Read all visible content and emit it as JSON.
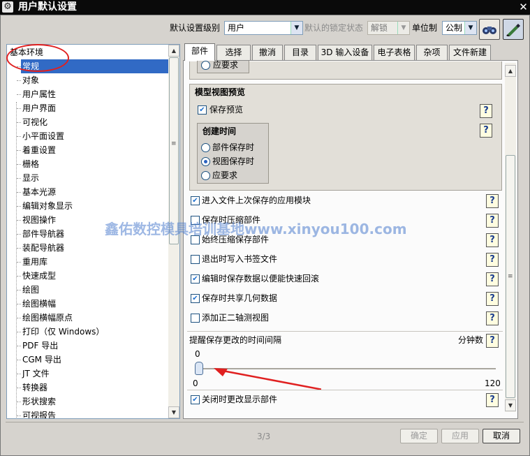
{
  "window": {
    "title": "用户默认设置",
    "close_icon": "✕"
  },
  "toolbar": {
    "level_label": "默认设置级别",
    "level_value": "用户",
    "lock_label": "默认的锁定状态",
    "lock_value": "解锁",
    "unit_label": "单位制",
    "unit_value": "公制"
  },
  "tree": {
    "root": "基本环境",
    "items": [
      "常规",
      "对象",
      "用户属性",
      "用户界面",
      "可视化",
      "小平面设置",
      "着重设置",
      "栅格",
      "显示",
      "基本光源",
      "编辑对象显示",
      "视图操作",
      "部件导航器",
      "装配导航器",
      "重用库",
      "快速成型",
      "绘图",
      "绘图横幅",
      "绘图横幅原点",
      "打印（仅 Windows）",
      "PDF 导出",
      "CGM 导出",
      "JT 文件",
      "转换器",
      "形状搜索",
      "可视报告"
    ],
    "selected_index": 0
  },
  "tabs": [
    "部件",
    "选择",
    "撤消",
    "目录",
    "3D 输入设备",
    "电子表格",
    "杂项",
    "文件新建"
  ],
  "active_tab": "部件",
  "panel": {
    "top_partial": "应要求",
    "model_preview": {
      "title": "模型视图预览",
      "save_preview_label": "保存预览",
      "save_preview_checked": true,
      "create_time": {
        "title": "创建时间",
        "options": [
          "部件保存时",
          "视图保存时",
          "应要求"
        ],
        "selected": "视图保存时"
      }
    },
    "options": [
      {
        "label": "进入文件上次保存的应用模块",
        "checked": true
      },
      {
        "label": "保存时压缩部件",
        "checked": false
      },
      {
        "label": "始终压缩保存部件",
        "checked": false
      },
      {
        "label": "退出时写入书签文件",
        "checked": false
      },
      {
        "label": "编辑时保存数据以便能快速回滚",
        "checked": true
      },
      {
        "label": "保存时共享几何数据",
        "checked": true
      },
      {
        "label": "添加正二轴测视图",
        "checked": false
      }
    ],
    "interval": {
      "label": "提醒保存更改的时间间隔",
      "unit": "分钟数",
      "current": "0",
      "min": "0",
      "max": "120"
    },
    "close_display": {
      "label": "关闭时更改显示部件",
      "checked": true
    }
  },
  "watermark": "鑫佑数控模具培训基地www.xinyou100.com",
  "footer": {
    "page": "3/3",
    "ok": "确定",
    "apply": "应用",
    "cancel": "取消"
  },
  "icons": {
    "help": "?",
    "check": "✔",
    "dropdown": "▼",
    "scroll_up": "▲",
    "scroll_down": "▼",
    "grip": "≡"
  },
  "colors": {
    "selection": "#316ac5",
    "annotation": "#e02020",
    "watermark": "#4f7fcf"
  }
}
